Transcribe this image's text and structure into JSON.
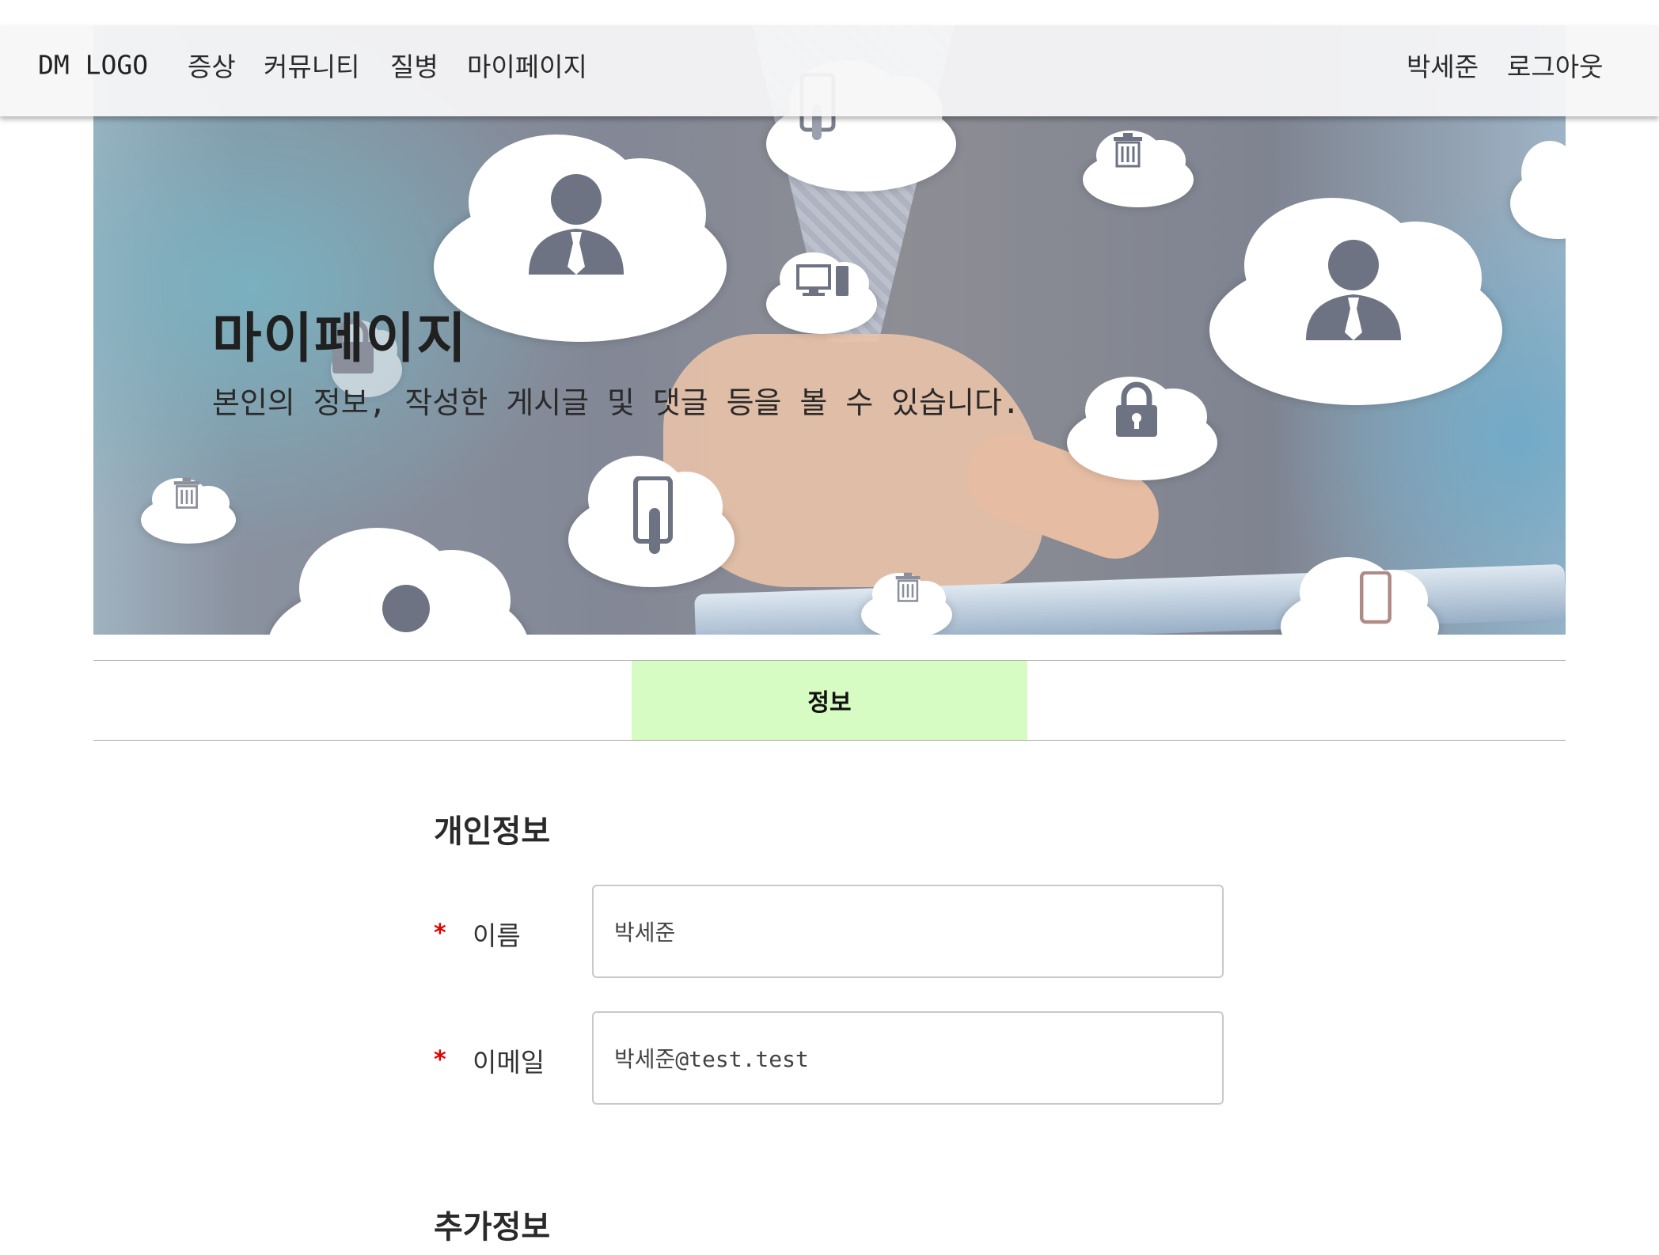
{
  "navbar": {
    "logo": "DM LOGO",
    "menu": [
      "증상",
      "커뮤니티",
      "질병",
      "마이페이지"
    ],
    "user_name": "박세준",
    "logout_label": "로그아웃"
  },
  "hero": {
    "title": "마이페이지",
    "subtitle": "본인의 정보, 작성한 게시글 및 댓글 등을 볼 수 있습니다."
  },
  "tabs": [
    {
      "label": "정보",
      "active": true
    }
  ],
  "personal_info": {
    "title": "개인정보",
    "name_label": "이름",
    "name_value": "박세준",
    "email_label": "이메일",
    "email_value": "박세준@test.test",
    "required_mark": "*"
  },
  "extra_info": {
    "title": "추가정보"
  },
  "colors": {
    "active_tab": "#d6fbc3",
    "required": "#e00000",
    "navbar_bg": "#f6f7f8"
  },
  "hero_icons": [
    "user-icon",
    "lock-icon",
    "trash-icon",
    "phone-touch-icon",
    "desktop-icon"
  ]
}
